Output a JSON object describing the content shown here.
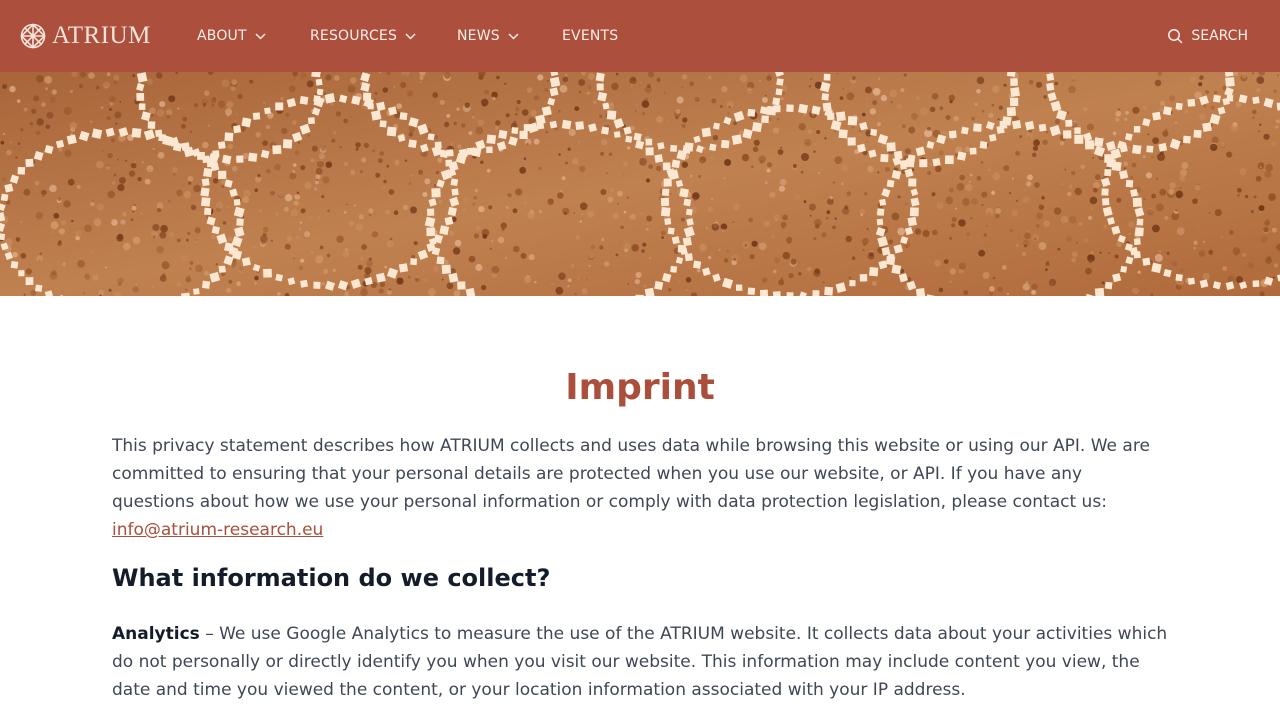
{
  "header": {
    "logo_text": "ATRIUM",
    "nav": [
      {
        "label": "ABOUT",
        "has_dropdown": true
      },
      {
        "label": "RESOURCES",
        "has_dropdown": true
      },
      {
        "label": "NEWS",
        "has_dropdown": true
      },
      {
        "label": "EVENTS",
        "has_dropdown": false
      }
    ],
    "search_label": "SEARCH",
    "background_color": "#ac4f3d"
  },
  "hero": {
    "image": "mosaic-texture",
    "tone": "#b86f3e"
  },
  "main": {
    "title": "Imprint",
    "intro_text": "This privacy statement describes how ATRIUM collects and uses data while browsing this website or using our API. We are committed to ensuring that your personal details are protected when you use our website, or API. If you have any questions about how we use your personal information or comply with data protection legislation, please contact us: ",
    "contact_email": "info@atrium-research.eu",
    "section_title": "What information do we collect?",
    "analytics_label": "Analytics",
    "analytics_text": " – We use Google Analytics to measure the use of the ATRIUM website. It collects data about your activities which do not personally or directly identify you when you visit our website. This information may include content you view, the date and time you viewed the content, or your location information associated with your IP address.",
    "accent_color": "#a94f3c"
  }
}
